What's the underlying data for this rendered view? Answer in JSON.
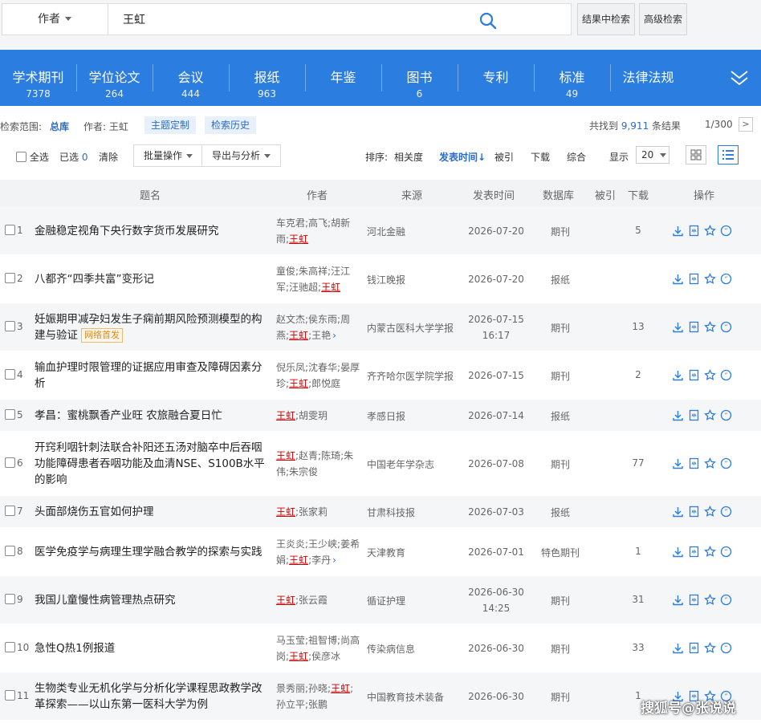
{
  "search": {
    "field": "作者",
    "query": "王虹",
    "btn_in_results": "结果中检索",
    "btn_advanced": "高级检索"
  },
  "tabs": [
    {
      "label": "学术期刊",
      "count": "7378"
    },
    {
      "label": "学位论文",
      "count": "264"
    },
    {
      "label": "会议",
      "count": "444"
    },
    {
      "label": "报纸",
      "count": "963"
    },
    {
      "label": "年鉴",
      "count": ""
    },
    {
      "label": "图书",
      "count": "6"
    },
    {
      "label": "专利",
      "count": ""
    },
    {
      "label": "标准",
      "count": "49"
    },
    {
      "label": "法律法规",
      "count": ""
    }
  ],
  "scope": {
    "label": "检索范围:",
    "range": "总库",
    "author_label": "作者:",
    "author": "王虹",
    "chip1": "主题定制",
    "chip2": "检索历史",
    "found_prefix": "共找到",
    "found_count": "9,911",
    "found_suffix": "条结果",
    "pager": "1/300",
    "next": ">"
  },
  "toolbar": {
    "select_all": "全选",
    "selected_prefix": "已选",
    "selected_count": "0",
    "clear": "清除",
    "batch": "批量操作",
    "export": "导出与分析",
    "sort_label": "排序:",
    "sort_relevance": "相关度",
    "sort_date": "发表时间",
    "sort_cited": "被引",
    "sort_download": "下载",
    "sort_overall": "综合",
    "show_label": "显示",
    "page_size": "20"
  },
  "columns": {
    "title": "题名",
    "author": "作者",
    "source": "来源",
    "date": "发表时间",
    "db": "数据库",
    "cited": "被引",
    "download": "下载",
    "ops": "操作"
  },
  "rows": [
    {
      "num": "1",
      "title": "金融稳定视角下央行数字货币发展研究",
      "badge": "",
      "authors": "车克君;高飞;胡新雨;",
      "hl": "王虹",
      "more": "",
      "source": "河北金融",
      "date": "2026-07-20",
      "db": "期刊",
      "dl": "5"
    },
    {
      "num": "2",
      "title": "八都齐“四季共富”变形记",
      "badge": "",
      "authors": "童俊;朱高祥;汪江军;汪驰超;",
      "hl": "王虹",
      "more": "",
      "source": "钱江晚报",
      "date": "2026-07-20",
      "db": "报纸",
      "dl": ""
    },
    {
      "num": "3",
      "title": "妊娠期甲减孕妇发生子痫前期风险预测模型的构建与验证",
      "badge": "网络首发",
      "authors": "赵文杰;侯东雨;周燕;",
      "hl": "王虹",
      "after": ";王艳",
      "more": "›",
      "source": "内蒙古医科大学学报",
      "date": "2026-07-15 16:17",
      "db": "期刊",
      "dl": "13"
    },
    {
      "num": "4",
      "title": "输血护理时限管理的证据应用审查及障碍因素分析",
      "badge": "",
      "authors": "倪乐凤;沈春华;晏厚珍;",
      "hl": "王虹",
      "after": ";郎悦庭",
      "more": "",
      "source": "齐齐哈尔医学院学报",
      "date": "2026-07-15",
      "db": "期刊",
      "dl": "2"
    },
    {
      "num": "5",
      "title": "孝昌：蜜桃飘香产业旺 农旅融合夏日忙",
      "badge": "",
      "authors": "",
      "hl": "王虹",
      "after": ";胡雯玥",
      "more": "",
      "source": "孝感日报",
      "date": "2026-07-14",
      "db": "报纸",
      "dl": ""
    },
    {
      "num": "6",
      "title": "开窍利咽针刺法联合补阳还五汤对脑卒中后吞咽功能障碍患者吞咽功能及血清NSE、S100B水平的影响",
      "badge": "",
      "authors": "",
      "hl": "王虹",
      "after": ";赵青;陈琦;朱伟;朱宗俊",
      "more": "",
      "source": "中国老年学杂志",
      "date": "2026-07-08",
      "db": "期刊",
      "dl": "77"
    },
    {
      "num": "7",
      "title": "头面部烧伤五官如何护理",
      "badge": "",
      "authors": "",
      "hl": "王虹",
      "after": ";张家莉",
      "more": "",
      "source": "甘肃科技报",
      "date": "2026-07-03",
      "db": "报纸",
      "dl": ""
    },
    {
      "num": "8",
      "title": "医学免疫学与病理生理学融合教学的探索与实践",
      "badge": "",
      "authors": "王炎炎;王少峡;姜希娟;",
      "hl": "王虹",
      "after": ";李丹",
      "more": "›",
      "source": "天津教育",
      "date": "2026-07-01",
      "db": "特色期刊",
      "dl": "1"
    },
    {
      "num": "9",
      "title": "我国儿童慢性病管理热点研究",
      "badge": "",
      "authors": "",
      "hl": "王虹",
      "after": ";张云霞",
      "more": "",
      "source": "循证护理",
      "date": "2026-06-30 14:25",
      "db": "期刊",
      "dl": "31"
    },
    {
      "num": "10",
      "title": "急性Q热1例报道",
      "badge": "",
      "authors": "马玉莹;祖智博;尚高岗;",
      "hl": "王虹",
      "after": ";侯彦冰",
      "more": "",
      "source": "传染病信息",
      "date": "2026-06-30",
      "db": "期刊",
      "dl": "33"
    },
    {
      "num": "11",
      "title": "生物类专业无机化学与分析化学课程思政教学改革探索——以山东第一医科大学为例",
      "badge": "",
      "authors": "景秀丽;孙晓;",
      "hl": "王虹",
      "after": ";孙立平;张鹏",
      "more": "",
      "source": "中国教育技术装备",
      "date": "2026-06-30",
      "db": "期刊",
      "dl": "1"
    }
  ],
  "watermark": "搜狐号@张说说"
}
